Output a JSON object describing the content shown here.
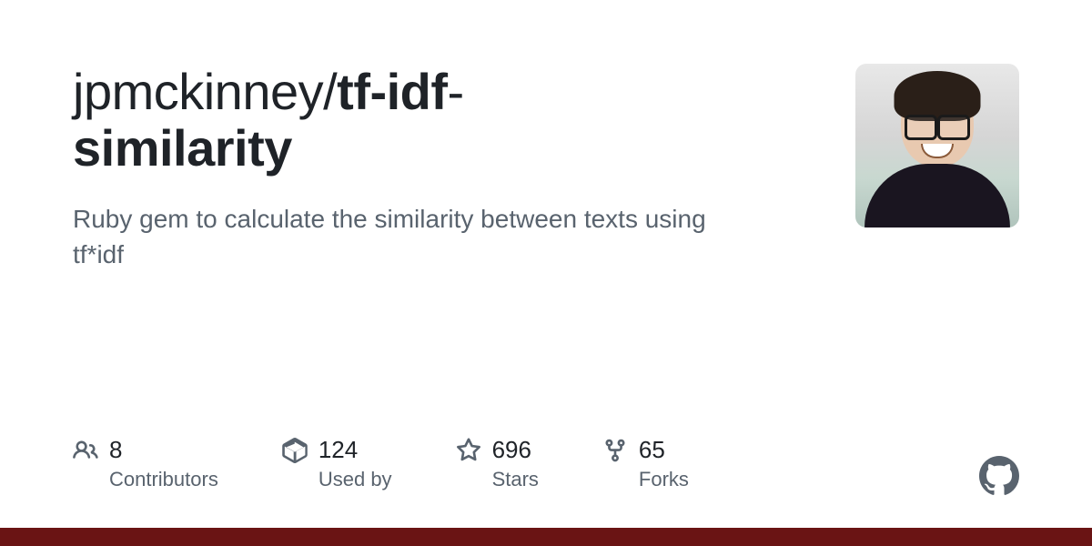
{
  "repo": {
    "owner": "jpmckinney",
    "name_part1": "tf-idf",
    "name_part2": "similarity",
    "description": "Ruby gem to calculate the similarity between texts using tf*idf"
  },
  "stats": {
    "contributors": {
      "count": "8",
      "label": "Contributors"
    },
    "usedby": {
      "count": "124",
      "label": "Used by"
    },
    "stars": {
      "count": "696",
      "label": "Stars"
    },
    "forks": {
      "count": "65",
      "label": "Forks"
    }
  },
  "accent_color": "#6a1414"
}
